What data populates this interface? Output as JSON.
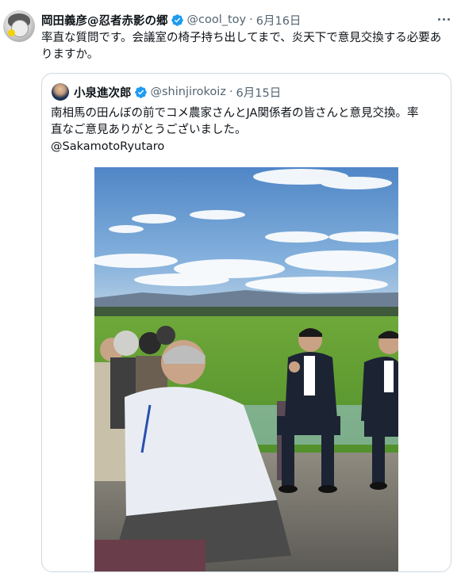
{
  "tweet": {
    "author_name": "岡田義彦@忍者赤影の郷",
    "author_handle": "@cool_toy",
    "separator": "·",
    "date": "6月16日",
    "text": "率直な質問です。会議室の椅子持ち出してまで、炎天下で意見交換する必要ありますか。",
    "more_icon": "more-horizontal-icon",
    "verified_icon": "verified-badge-icon"
  },
  "quoted": {
    "author_name": "小泉進次郎",
    "author_handle": "@shinjirokoiz",
    "separator": "·",
    "date": "6月15日",
    "text_line1": "南相馬の田んぼの前でコメ農家さんとJA関係者の皆さんと意見交換。率",
    "text_line2": "直なご意見ありがとうございました。",
    "mention": "@SakamotoRyutaro"
  },
  "colors": {
    "text": "#0f1419",
    "secondary": "#536471",
    "verified": "#1d9bf0",
    "border": "#cfd9de"
  }
}
